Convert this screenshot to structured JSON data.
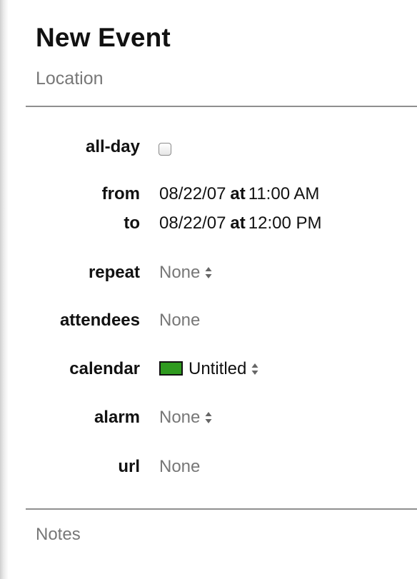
{
  "event": {
    "title": "New Event",
    "location_placeholder": "Location",
    "notes_placeholder": "Notes"
  },
  "fields": {
    "all_day": {
      "label": "all-day",
      "checked": false
    },
    "from": {
      "label": "from",
      "date": "08/22/07",
      "at": "at",
      "time": "11:00 AM"
    },
    "to": {
      "label": "to",
      "date": "08/22/07",
      "at": "at",
      "time": "12:00 PM"
    },
    "repeat": {
      "label": "repeat",
      "value": "None",
      "icon": "updown-stepper-icon"
    },
    "attendees": {
      "label": "attendees",
      "value": "None"
    },
    "calendar": {
      "label": "calendar",
      "value": "Untitled",
      "color": "#2f9a1f",
      "icon": "updown-stepper-icon"
    },
    "alarm": {
      "label": "alarm",
      "value": "None",
      "icon": "updown-stepper-icon"
    },
    "url": {
      "label": "url",
      "value": "None"
    }
  }
}
